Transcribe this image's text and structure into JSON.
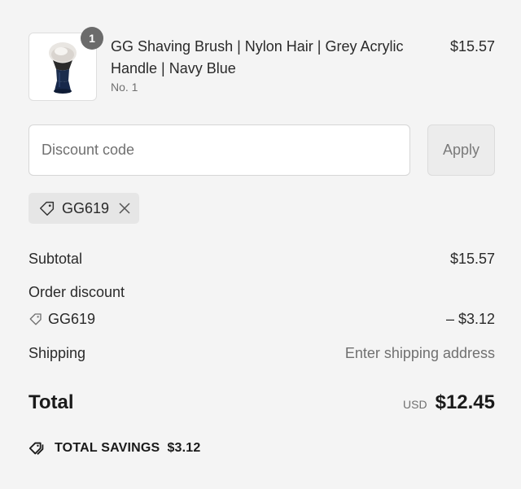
{
  "line_item": {
    "quantity": "1",
    "title": "GG Shaving Brush | Nylon Hair | Grey Acrylic Handle | Navy Blue",
    "variant": "No. 1",
    "price": "$15.57",
    "image_icon": "shaving-brush-image"
  },
  "discount": {
    "placeholder": "Discount code",
    "apply_label": "Apply",
    "applied_code": "GG619"
  },
  "summary": {
    "subtotal_label": "Subtotal",
    "subtotal_value": "$15.57",
    "order_discount_label": "Order discount",
    "discount_code": "GG619",
    "discount_value": "– $3.12",
    "shipping_label": "Shipping",
    "shipping_value": "Enter shipping address",
    "total_label": "Total",
    "currency": "USD",
    "total_value": "$12.45",
    "savings_label": "TOTAL SAVINGS",
    "savings_value": "$3.12"
  },
  "colors": {
    "background": "#f4f4f4",
    "badge": "#6b6b6b",
    "muted_text": "#707070",
    "chip_bg": "#e6e6e6"
  }
}
